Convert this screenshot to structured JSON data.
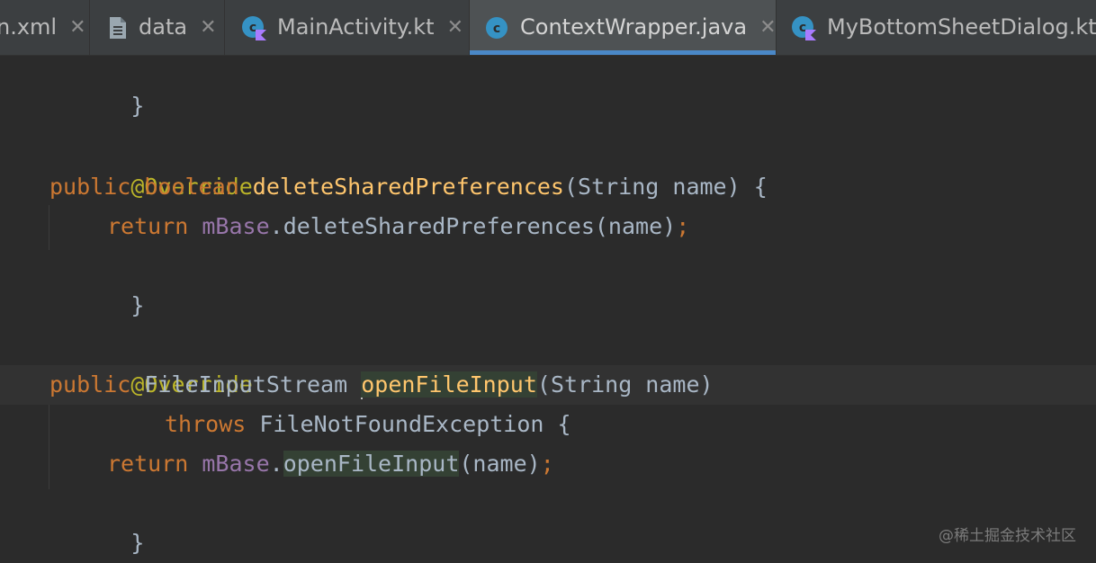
{
  "tabs": [
    {
      "label": "n.xml",
      "icon": "none",
      "closable": true,
      "active": false
    },
    {
      "label": "data",
      "icon": "file-icon",
      "closable": true,
      "active": false
    },
    {
      "label": "MainActivity.kt",
      "icon": "kotlin-class-icon",
      "closable": true,
      "active": false
    },
    {
      "label": "ContextWrapper.java",
      "icon": "java-class-icon",
      "closable": true,
      "active": true
    },
    {
      "label": "MyBottomSheetDialog.kt",
      "icon": "kotlin-class-icon",
      "closable": false,
      "active": false
    }
  ],
  "close_glyph": "✕",
  "code": {
    "l1": {
      "brace": "}"
    },
    "l3": {
      "annotation": "@Override"
    },
    "l4": {
      "kw1": "public",
      "kw2": "boolean",
      "method": "deleteSharedPreferences",
      "params": "(String name) {"
    },
    "l5": {
      "kw": "return",
      "field": "mBase",
      "call": ".deleteSharedPreferences(name)",
      "semi": ";"
    },
    "l6": {
      "brace": "}"
    },
    "l8": {
      "annotation": "@Override"
    },
    "l9": {
      "kw": "public",
      "type": "FileInputStream",
      "method": "openFileInput",
      "params": "(String name)"
    },
    "l10": {
      "kw": "throws",
      "rest": "FileNotFoundException {"
    },
    "l11": {
      "kw": "return",
      "field": "mBase",
      "dot": ".",
      "call": "openFileInput",
      "args": "(name)",
      "semi": ";"
    },
    "l12": {
      "brace": "}"
    }
  },
  "watermark": "@稀土掘金技术社区",
  "colors": {
    "keyword": "#cc7832",
    "annotation": "#bbb529",
    "method_decl": "#ffc66d",
    "field": "#9876aa",
    "text": "#a9b7c6",
    "active_tab_underline": "#4a88c7"
  }
}
